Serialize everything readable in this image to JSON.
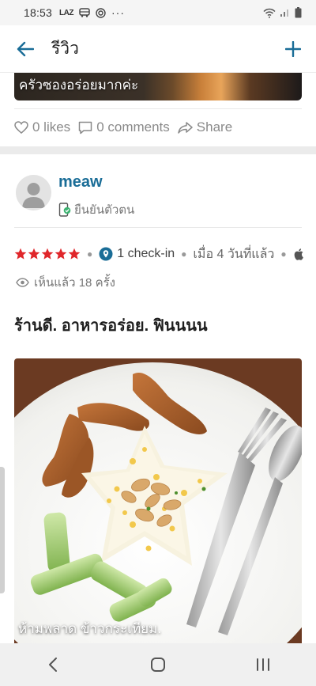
{
  "status_bar": {
    "time": "18:53",
    "notification_icons": [
      "LAZ",
      "bus-icon",
      "cast-icon",
      "more-dots"
    ],
    "more": "···"
  },
  "app_bar": {
    "title": "รีวิว",
    "back_icon": "arrow-left-icon",
    "add_icon": "plus-icon",
    "accent_color": "#1a6d97"
  },
  "previous_post": {
    "caption": "ครัวซองอร่อยมากค่ะ",
    "likes": "0 likes",
    "comments": "0 comments",
    "share": "Share"
  },
  "review": {
    "username": "meaw",
    "verified_label": "ยืนยันตัวตน",
    "rating": 5,
    "rating_max": 5,
    "star_color": "#e0262a",
    "checkin": "1 check-in",
    "posted": "เมื่อ 4 วันที่แล้ว",
    "views": "เห็นแล้ว 18 ครั้ง",
    "title": "ร้านดี. อาหารอร่อย. ฟินนนน",
    "photo_caption": "ห้ามพลาด ข้าวกระเทียม."
  },
  "nav_bar": {
    "buttons": [
      "back-icon",
      "home-icon",
      "recents-icon"
    ]
  }
}
